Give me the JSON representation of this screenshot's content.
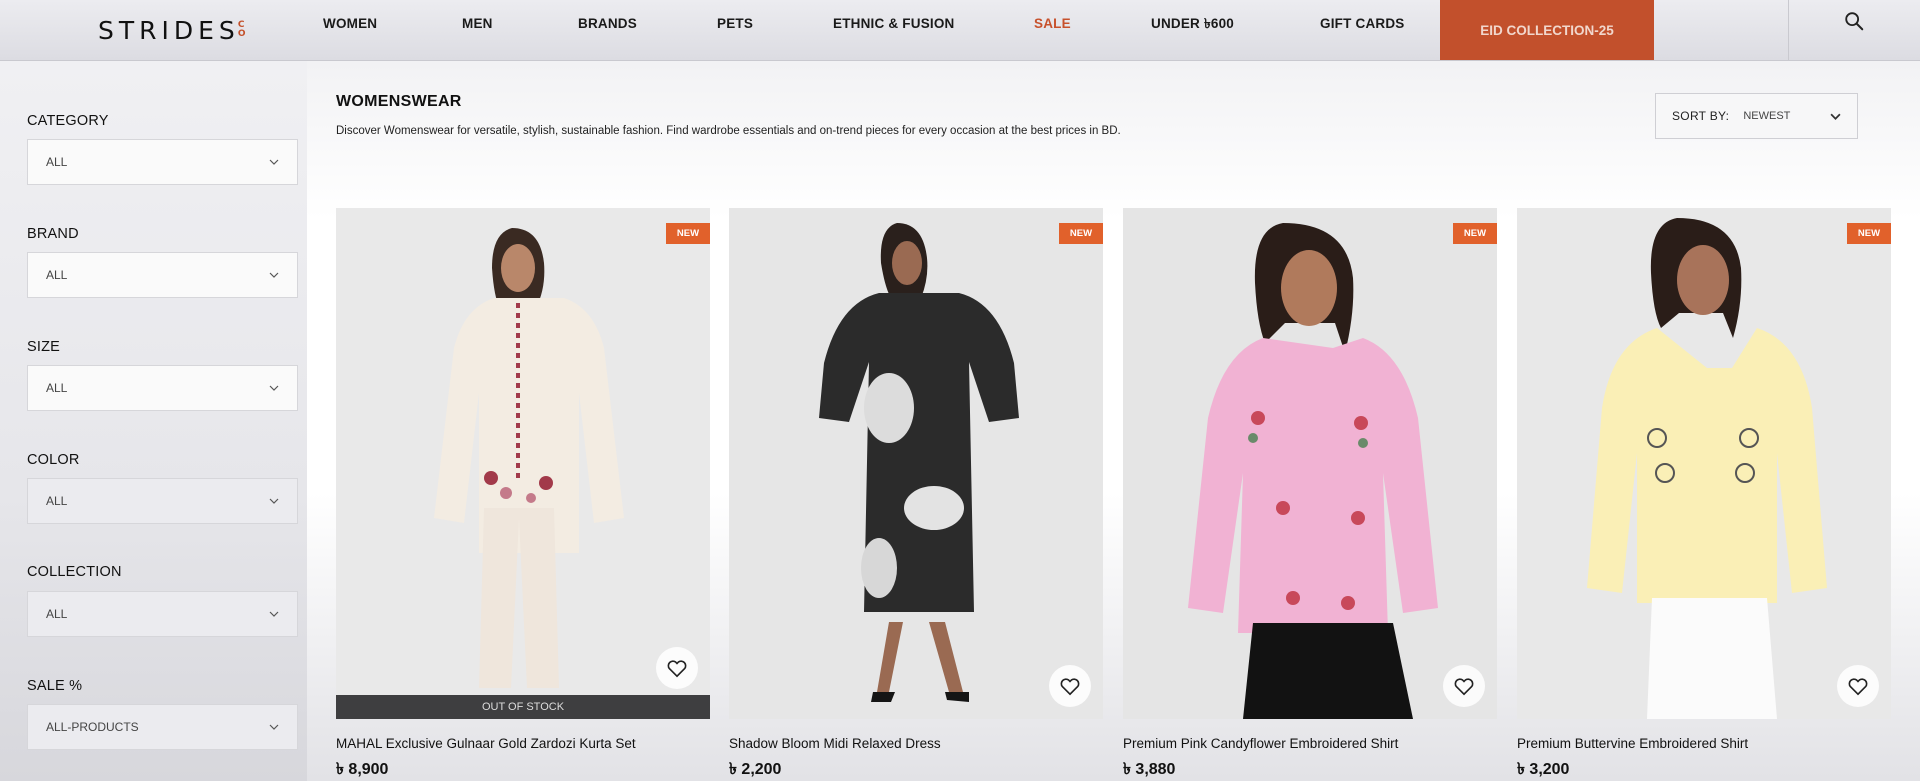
{
  "brand": {
    "logo_text": "STRIDES",
    "logo_suffix_top": "C",
    "logo_suffix_bottom": "O"
  },
  "nav": {
    "items": [
      {
        "label": "WOMEN"
      },
      {
        "label": "MEN"
      },
      {
        "label": "BRANDS"
      },
      {
        "label": "PETS"
      },
      {
        "label": "ETHNIC & FUSION"
      },
      {
        "label": "SALE"
      },
      {
        "label": "UNDER ৳600"
      },
      {
        "label": "GIFT CARDS"
      }
    ],
    "highlight": "EID COLLECTION-25",
    "search_icon": "search-icon"
  },
  "filters": [
    {
      "label": "CATEGORY",
      "value": "ALL"
    },
    {
      "label": "BRAND",
      "value": "ALL"
    },
    {
      "label": "SIZE",
      "value": "ALL"
    },
    {
      "label": "COLOR",
      "value": "ALL"
    },
    {
      "label": "COLLECTION",
      "value": "ALL"
    },
    {
      "label": "SALE %",
      "value": "ALL-PRODUCTS"
    }
  ],
  "page": {
    "title": "WOMENSWEAR",
    "description": "Discover Womenswear for versatile, stylish, sustainable fashion. Find wardrobe essentials and on-trend pieces for every occasion at the best prices in BD."
  },
  "sort": {
    "label": "SORT BY:",
    "value": "NEWEST"
  },
  "products": [
    {
      "name": "MAHAL Exclusive Gulnaar Gold Zardozi Kurta Set",
      "price": "৳ 8,900",
      "badge": "NEW",
      "status": "OUT OF STOCK"
    },
    {
      "name": "Shadow Bloom Midi Relaxed Dress",
      "price": "৳ 2,200",
      "badge": "NEW"
    },
    {
      "name": "Premium Pink Candyflower Embroidered Shirt",
      "price": "৳ 3,880",
      "badge": "NEW"
    },
    {
      "name": "Premium Buttervine Embroidered Shirt",
      "price": "৳ 3,200",
      "badge": "NEW"
    }
  ],
  "colors": {
    "accent": "#c2502c",
    "badge": "#e1612b",
    "sale_text": "#c7512c",
    "oos_bar": "#3e3e40"
  }
}
